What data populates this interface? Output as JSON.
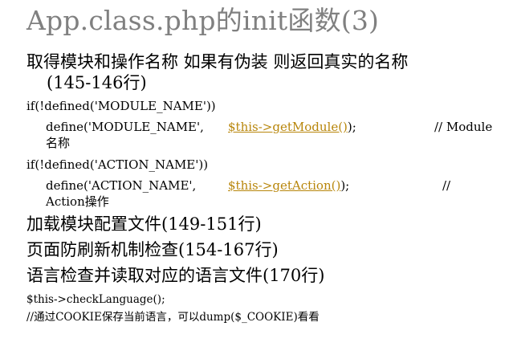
{
  "slide": {
    "title": "App.class.php的init函数(3)",
    "point1": {
      "line1": "取得模块和操作名称 如果有伪装 则返回真实的名称",
      "line2": "(145-146行)"
    },
    "code_module": {
      "if_line": "if(!defined('MODULE_NAME'))",
      "define_prefix": "define('MODULE_NAME',",
      "call": "$this->getModule()",
      "semicolon": ");",
      "comment_part1": "// Module",
      "comment_part2": "名称"
    },
    "code_action": {
      "if_line": "if(!defined('ACTION_NAME'))",
      "define_prefix": "define('ACTION_NAME',",
      "call": "$this->getAction()",
      "semicolon": ");",
      "comment_part1": "//",
      "comment_part2": "Action操作"
    },
    "point2": "加载模块配置文件(149-151行)",
    "point3": "页面防刷新机制检查(154-167行)",
    "point4": "语言检查并读取对应的语言文件(170行)",
    "code_lang": {
      "line1": "$this->checkLanguage();",
      "line2": "//通过COOKIE保存当前语言，可以dump($_COOKIE)看看"
    },
    "colors": {
      "title": "#808080",
      "link": "#b8860b"
    }
  }
}
